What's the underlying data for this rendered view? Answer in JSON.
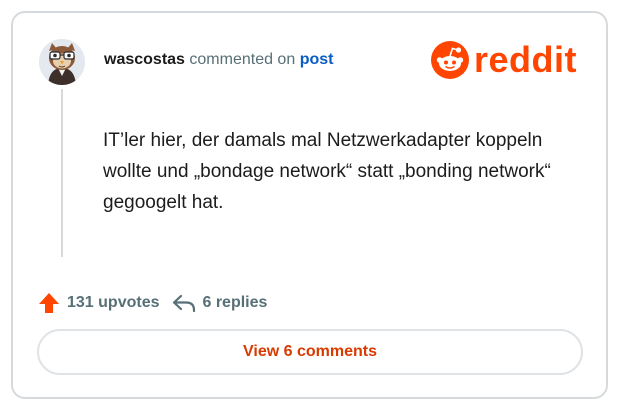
{
  "comment": {
    "author": "wascostas",
    "action_text": "commented on",
    "target_link": "post",
    "text": "IT’ler hier, der damals mal Netzwerkadapter koppeln wollte und „bondage network“ statt „bonding network“ gegoogelt hat."
  },
  "brand": {
    "wordmark": "reddit",
    "color": "#ff4500"
  },
  "stats": {
    "upvotes": "131 upvotes",
    "replies": "6 replies"
  },
  "view_comments_label": "View 6 comments",
  "colors": {
    "link": "#0a5dc2",
    "upvote": "#ff4500",
    "button_text": "#d93a00",
    "muted": "#576f76"
  },
  "icons": {
    "avatar": "cartoon-owl-avatar",
    "upvote": "upvote-arrow-icon",
    "reply": "reply-arrow-icon",
    "logo": "reddit-snoo-icon"
  }
}
